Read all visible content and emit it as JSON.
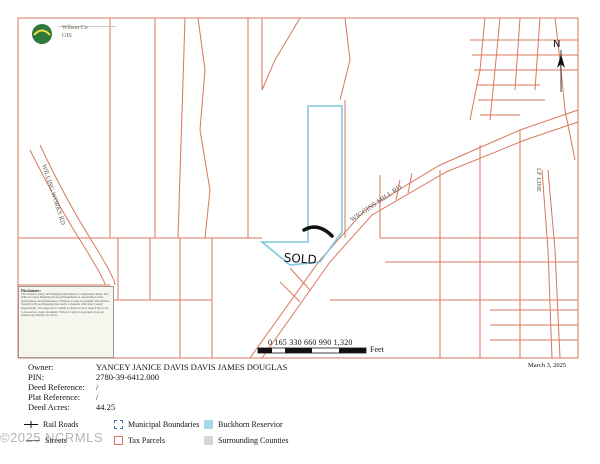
{
  "header": {
    "logo_line1": "Wilson Co",
    "logo_line2": "GIS"
  },
  "map": {
    "road_labels": {
      "wiggins_mill": "WIGGINS MILL RD",
      "wilson_works": "WILLING WORKS RD",
      "lf_line": "LF LINE"
    },
    "annotation": "SOLD",
    "north_label": "N",
    "disclaimer_title": "Disclaimer:",
    "disclaimer_body": "The Wilson County GIS Mapping Department is a Registered name. The Wilson County Mapping Section (Department) is responsible for the development and maintenance of Wilson County Geographic Information System (GIS) and mapping data and is consistent with other County Departments. It is expected to remain accurate in every regard, but is not to be used as a legal document. Wilson County Government does not assume any liability for errors."
  },
  "scale_bar": {
    "ticks": "0  165 330      660      990     1,320",
    "unit": "Feet"
  },
  "date": "March 3, 2025",
  "parcel": [
    {
      "label": "Owner:",
      "value": "YANCEY JANICE DAVIS DAVIS JAMES DOUGLAS"
    },
    {
      "label": "PIN:",
      "value": "2780-39-6412.000"
    },
    {
      "label": "Deed Reference:",
      "value": "/"
    },
    {
      "label": "Plat Reference:",
      "value": "/"
    },
    {
      "label": "Deed Acres:",
      "value": "44.25"
    }
  ],
  "legend": {
    "rail": "Rail Roads",
    "municipal": "Municipal Boundaries",
    "buckhorn": "Buckhorn Reservior",
    "streets": "Streets",
    "tax": "Tax Parcels",
    "surrounding": "Surrounding Counties"
  },
  "colors": {
    "parcel_line": "#d9775e",
    "subject_parcel": "#7ec8dc",
    "reservoir_fill": "#a7d9e6",
    "surrounding_fill": "#d6d6d6"
  },
  "watermark": "©2025 NCRMLS"
}
